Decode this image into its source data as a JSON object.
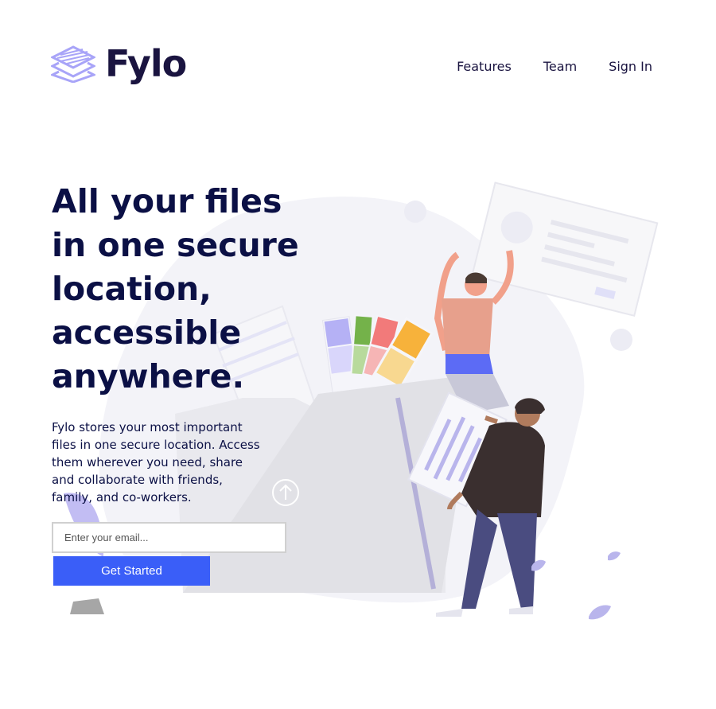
{
  "brand": {
    "name": "Fylo"
  },
  "nav": {
    "items": [
      {
        "label": "Features"
      },
      {
        "label": "Team"
      },
      {
        "label": "Sign In"
      }
    ]
  },
  "hero": {
    "title": "All your files in one secure location, accessible anywhere.",
    "description": "Fylo stores your most important files in one secure location. Access them wherever you need, share and collaborate with friends, family, and co-workers.",
    "email_placeholder": "Enter your email...",
    "cta_label": "Get Started"
  },
  "colors": {
    "accent": "#3a5ef8",
    "heading": "#0b1045",
    "logo_purple": "#a8a4f8",
    "blob": "#f2f2f8"
  },
  "icons": [
    "layers-logo-icon",
    "upload-arrow-icon",
    "leaf-icon"
  ]
}
